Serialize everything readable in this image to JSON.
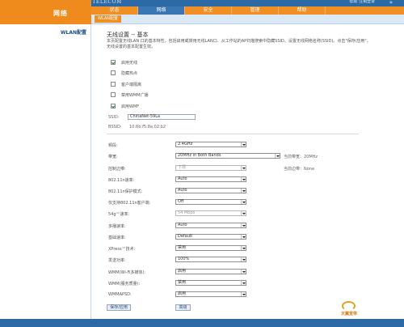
{
  "header": {
    "brand": "CHINA TELECOM",
    "top_right": "帮助  注销登录",
    "section": "网络"
  },
  "nav": {
    "tabs": [
      "状态",
      "网络",
      "安全",
      "管理",
      "帮助"
    ],
    "active_index": 1
  },
  "subnav": {
    "active": "WLAN配置"
  },
  "sidebar": {
    "items": [
      {
        "label": "WLAN配置"
      }
    ]
  },
  "main": {
    "title": "无线设置 -- 基本",
    "description": "本页配置无线LAN 口的基本特性，包括启用或禁用无线LAN口、从工作站的AP扫描搜索中隐藏SSID、设置无线网络名称(SSID)。点击\"保存/应用\"，无线设置的基本配置生效。",
    "checkboxes": [
      {
        "label": "启用无线",
        "checked": true
      },
      {
        "label": "隐藏热点",
        "checked": false
      },
      {
        "label": "客户端隔离",
        "checked": false
      },
      {
        "label": "禁用WMM广播",
        "checked": false
      },
      {
        "label": "启用WMF",
        "checked": true
      }
    ],
    "ssid_label": "SSID:",
    "ssid_value": "ChinaNet-59La",
    "bssid_label": "BSSID:",
    "bssid_value": "10:6b:f5:8a:02:b2",
    "fields": [
      {
        "label": "频段:",
        "value": "2.4GHz",
        "disabled": false
      },
      {
        "label": "带宽:",
        "value": "20MHz in Both Bands",
        "disabled": false,
        "note": "当前带宽：20MHz"
      },
      {
        "label": "控制边带:",
        "value": "下限",
        "disabled": true,
        "note": "当前边带：None"
      },
      {
        "label": "802.11n速率:",
        "value": "Auto",
        "disabled": false
      },
      {
        "label": "802.11n保护模式:",
        "value": "Auto",
        "disabled": false
      },
      {
        "label": "仅支持802.11n客户端:",
        "value": "Off",
        "disabled": false
      },
      {
        "label": "54g™速率:",
        "value": "54 Mbps",
        "disabled": true
      },
      {
        "label": "多播速率:",
        "value": "Auto",
        "disabled": false
      },
      {
        "label": "基础速率:",
        "value": "Default",
        "disabled": false
      },
      {
        "label": "XPress™技术:",
        "value": "禁用",
        "disabled": false
      },
      {
        "label": "发送功率:",
        "value": "100%",
        "disabled": false
      },
      {
        "label": "WMM(Wi-Fi多媒体):",
        "value": "启用",
        "disabled": false
      },
      {
        "label": "WMM(服务质量):",
        "value": "禁用",
        "disabled": false
      },
      {
        "label": "WMMAPSD:",
        "value": "启用",
        "disabled": false
      }
    ],
    "buttons": {
      "save": "保存/应用",
      "advanced": "高级"
    }
  },
  "footer": {
    "logo_text": "天翼宽带"
  }
}
